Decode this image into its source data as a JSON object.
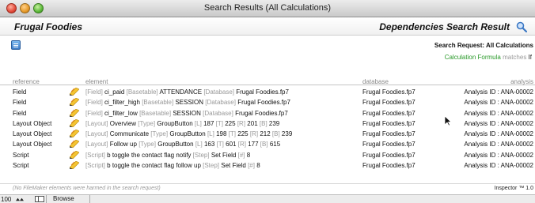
{
  "window": {
    "title": "Search Results (All Calculations)"
  },
  "header": {
    "app_name": "Frugal Foodies",
    "result_title": "Dependencies Search Result"
  },
  "search": {
    "request": "Search Request: All Calculations",
    "criteria_type": "Calculation Formula",
    "criteria_op": "matches",
    "criteria_value": "If"
  },
  "table": {
    "columns": [
      "reference",
      "element",
      "database",
      "analysis"
    ],
    "rows": [
      {
        "reference": "Field",
        "element": [
          [
            "tag",
            "[Field]"
          ],
          [
            "val",
            "ci_paid"
          ],
          [
            "tag",
            "[Basetable]"
          ],
          [
            "val",
            "ATTENDANCE"
          ],
          [
            "tag",
            "[Database]"
          ],
          [
            "val",
            "Frugal Foodies.fp7"
          ]
        ],
        "database": "Frugal Foodies.fp7",
        "analysis": "Analysis ID : ANA-00002"
      },
      {
        "reference": "Field",
        "element": [
          [
            "tag",
            "[Field]"
          ],
          [
            "val",
            "ci_filter_high"
          ],
          [
            "tag",
            "[Basetable]"
          ],
          [
            "val",
            "SESSION"
          ],
          [
            "tag",
            "[Database]"
          ],
          [
            "val",
            "Frugal Foodies.fp7"
          ]
        ],
        "database": "Frugal Foodies.fp7",
        "analysis": "Analysis ID : ANA-00002"
      },
      {
        "reference": "Field",
        "element": [
          [
            "tag",
            "[Field]"
          ],
          [
            "val",
            "ci_filter_low"
          ],
          [
            "tag",
            "[Basetable]"
          ],
          [
            "val",
            "SESSION"
          ],
          [
            "tag",
            "[Database]"
          ],
          [
            "val",
            "Frugal Foodies.fp7"
          ]
        ],
        "database": "Frugal Foodies.fp7",
        "analysis": "Analysis ID : ANA-00002"
      },
      {
        "reference": "Layout Object",
        "element": [
          [
            "tag",
            "[Layout]"
          ],
          [
            "val",
            "Overview"
          ],
          [
            "tag",
            "[Type]"
          ],
          [
            "val",
            "GroupButton"
          ],
          [
            "tag",
            "[L]"
          ],
          [
            "val",
            "187"
          ],
          [
            "tag",
            "[T]"
          ],
          [
            "val",
            "225"
          ],
          [
            "tag",
            "[R]"
          ],
          [
            "val",
            "201"
          ],
          [
            "tag",
            "[B]"
          ],
          [
            "val",
            "239"
          ]
        ],
        "database": "Frugal Foodies.fp7",
        "analysis": "Analysis ID : ANA-00002"
      },
      {
        "reference": "Layout Object",
        "element": [
          [
            "tag",
            "[Layout]"
          ],
          [
            "val",
            "Communicate"
          ],
          [
            "tag",
            "[Type]"
          ],
          [
            "val",
            "GroupButton"
          ],
          [
            "tag",
            "[L]"
          ],
          [
            "val",
            "198"
          ],
          [
            "tag",
            "[T]"
          ],
          [
            "val",
            "225"
          ],
          [
            "tag",
            "[R]"
          ],
          [
            "val",
            "212"
          ],
          [
            "tag",
            "[B]"
          ],
          [
            "val",
            "239"
          ]
        ],
        "database": "Frugal Foodies.fp7",
        "analysis": "Analysis ID : ANA-00002"
      },
      {
        "reference": "Layout Object",
        "element": [
          [
            "tag",
            "[Layout]"
          ],
          [
            "val",
            "Follow up"
          ],
          [
            "tag",
            "[Type]"
          ],
          [
            "val",
            "GroupButton"
          ],
          [
            "tag",
            "[L]"
          ],
          [
            "val",
            "163"
          ],
          [
            "tag",
            "[T]"
          ],
          [
            "val",
            "601"
          ],
          [
            "tag",
            "[R]"
          ],
          [
            "val",
            "177"
          ],
          [
            "tag",
            "[B]"
          ],
          [
            "val",
            "615"
          ]
        ],
        "database": "Frugal Foodies.fp7",
        "analysis": "Analysis ID : ANA-00002"
      },
      {
        "reference": "Script",
        "element": [
          [
            "tag",
            "[Script]"
          ],
          [
            "val",
            "b toggle the contact flag notify"
          ],
          [
            "tag",
            "[Step]"
          ],
          [
            "val",
            "Set Field"
          ],
          [
            "tag",
            "[#]"
          ],
          [
            "val",
            "8"
          ]
        ],
        "database": "Frugal Foodies.fp7",
        "analysis": "Analysis ID : ANA-00002"
      },
      {
        "reference": "Script",
        "element": [
          [
            "tag",
            "[Script]"
          ],
          [
            "val",
            "b toggle the contact flag follow up"
          ],
          [
            "tag",
            "[Step]"
          ],
          [
            "val",
            "Set Field"
          ],
          [
            "tag",
            "[#]"
          ],
          [
            "val",
            "8"
          ]
        ],
        "database": "Frugal Foodies.fp7",
        "analysis": "Analysis ID : ANA-00002"
      }
    ]
  },
  "footer": {
    "note": "(No FileMaker elements were harmed in the search request)",
    "brand": "Inspector ™ 1.0"
  },
  "statusbar": {
    "zoom": "100",
    "mode": "Browse"
  },
  "colors": {
    "criteria_green": "#2a9a2a",
    "tag_gray": "#999999"
  },
  "icons": {
    "magnifier": "magnifier-icon",
    "list": "list-view-icon",
    "row": "pencil-icon"
  }
}
